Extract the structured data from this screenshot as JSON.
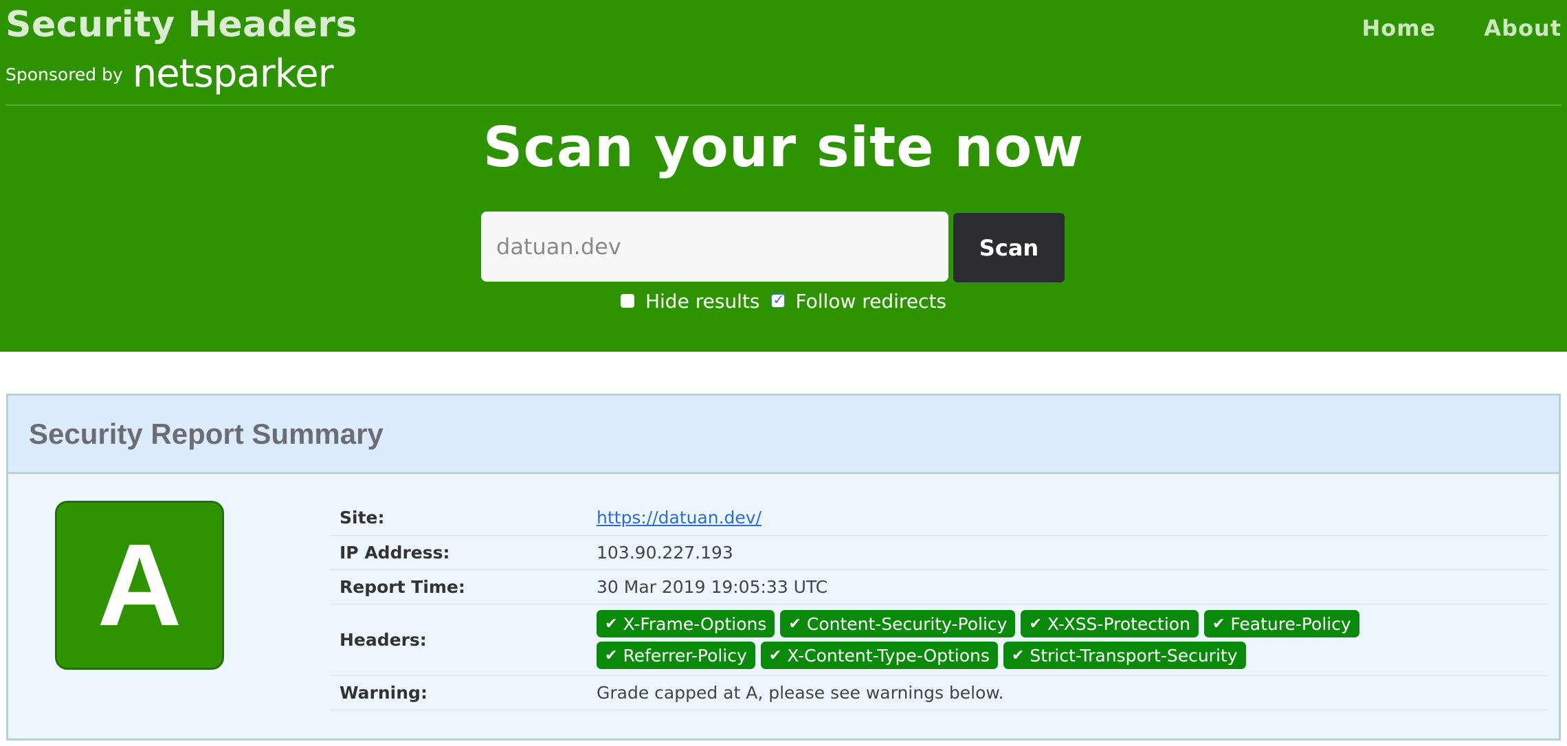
{
  "header": {
    "brand_title": "Security Headers",
    "sponsor_label": "Sponsored by",
    "sponsor_logo_text": "netsparker",
    "nav": [
      {
        "label": "Home"
      },
      {
        "label": "About"
      }
    ]
  },
  "hero": {
    "heading": "Scan your site now",
    "search_placeholder": "datuan.dev",
    "scan_label": "Scan",
    "options": [
      {
        "label": "Hide results",
        "checked": false
      },
      {
        "label": "Follow redirects",
        "checked": true
      }
    ]
  },
  "report": {
    "title": "Security Report Summary",
    "grade": "A",
    "rows": {
      "site": {
        "label": "Site:",
        "value": "https://datuan.dev/"
      },
      "ip": {
        "label": "IP Address:",
        "value": "103.90.227.193"
      },
      "time": {
        "label": "Report Time:",
        "value": "30 Mar 2019 19:05:33 UTC"
      },
      "headers": {
        "label": "Headers:"
      },
      "warning": {
        "label": "Warning:",
        "value": "Grade capped at A, please see warnings below."
      }
    },
    "header_badges": [
      "X-Frame-Options",
      "Content-Security-Policy",
      "X-XSS-Protection",
      "Feature-Policy",
      "Referrer-Policy",
      "X-Content-Type-Options",
      "Strict-Transport-Security"
    ]
  },
  "colors": {
    "hero_green": "#2d9400",
    "badge_green": "#0a8a0a",
    "scan_button": "#2b2d31",
    "report_bg": "#eef6fd"
  },
  "icons": {
    "badge_check": "check-icon",
    "checkbox_checked": "checkbox-checked-icon"
  }
}
